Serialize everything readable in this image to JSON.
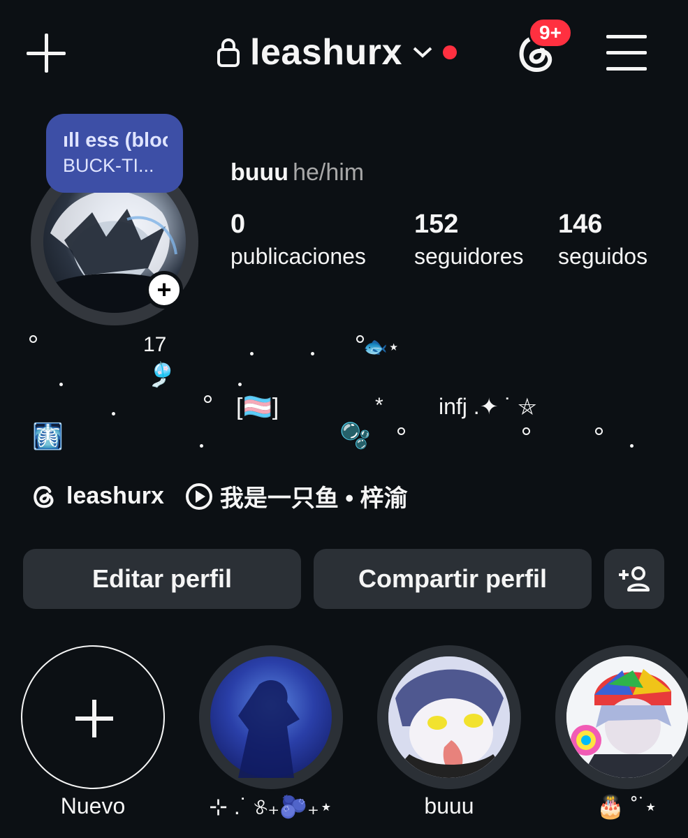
{
  "header": {
    "username": "leashurx",
    "notification_badge": "9+",
    "icons": {
      "create": "plus-icon",
      "lock": "lock-icon",
      "dropdown": "chevron-down-icon",
      "threads": "threads-icon",
      "menu": "hamburger-menu-icon"
    }
  },
  "profile": {
    "music_title": "ess (bloo",
    "music_artist": "BUCK-TI...",
    "display_name": "buuu",
    "pronouns": "he/him",
    "stats": [
      {
        "value": "0",
        "label": "publicaciones"
      },
      {
        "value": "152",
        "label": "seguidores"
      },
      {
        "value": "146",
        "label": "seguidos"
      }
    ]
  },
  "bio": {
    "number": "17",
    "flag_text": "[🏳️‍⚧️]",
    "star": "*",
    "infj": "infj .✦ ˙ ⛤",
    "emoji_fish": "🐟⋆",
    "emoji_bell": "🎐",
    "emoji_bubbles": "🫧",
    "emoji_xray": "🩻"
  },
  "links": {
    "threads_handle": "leashurx",
    "song": "我是一只鱼 • 梓渝"
  },
  "buttons": {
    "edit": "Editar perfil",
    "share": "Compartir perfil"
  },
  "highlights": [
    {
      "label": "Nuevo"
    },
    {
      "label": "⊹ .˙ ୫₊🫐₊⋆"
    },
    {
      "label": "buuu"
    },
    {
      "label": "🎂 ˚ ࣪⋆"
    }
  ],
  "colors": {
    "background": "#0c1014",
    "badge": "#ff3040",
    "button": "#2b3036",
    "music_bubble": "#3d4fa6"
  }
}
